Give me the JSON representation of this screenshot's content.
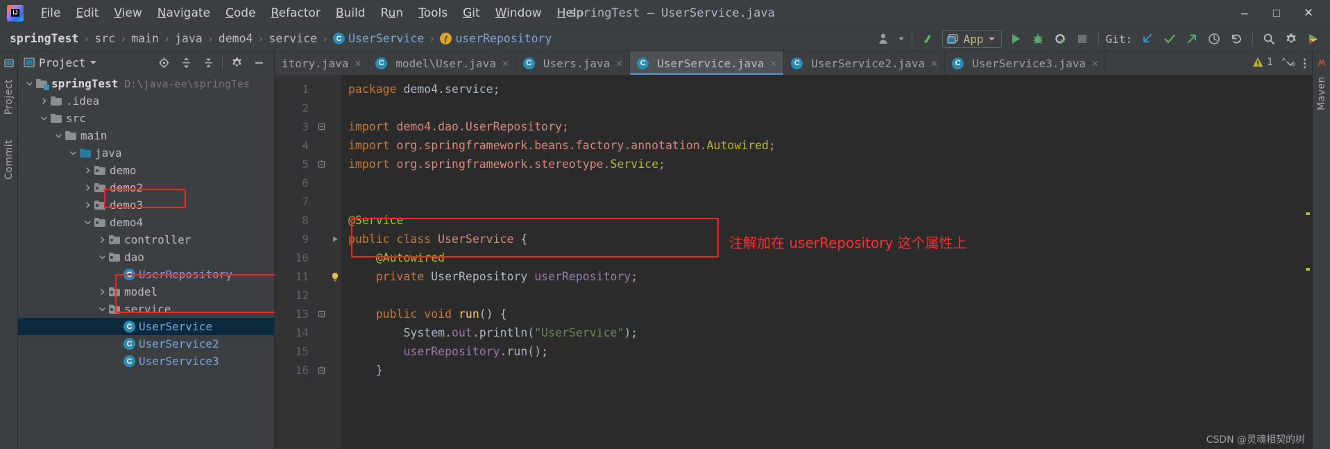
{
  "window": {
    "title": "springTest – UserService.java",
    "logo_text": "IJ",
    "controls": {
      "minimize": "–",
      "maximize": "□",
      "close": "✕"
    }
  },
  "menubar": {
    "items": [
      {
        "label": "File",
        "mnemonic": "F"
      },
      {
        "label": "Edit",
        "mnemonic": "E"
      },
      {
        "label": "View",
        "mnemonic": "V"
      },
      {
        "label": "Navigate",
        "mnemonic": "N"
      },
      {
        "label": "Code",
        "mnemonic": "C"
      },
      {
        "label": "Refactor",
        "mnemonic": "R"
      },
      {
        "label": "Build",
        "mnemonic": "B"
      },
      {
        "label": "Run",
        "mnemonic": "u"
      },
      {
        "label": "Tools",
        "mnemonic": "T"
      },
      {
        "label": "Git",
        "mnemonic": "G"
      },
      {
        "label": "Window",
        "mnemonic": "W"
      },
      {
        "label": "Help",
        "mnemonic": "H"
      }
    ]
  },
  "breadcrumb": {
    "items": [
      {
        "label": "springTest",
        "style": "bold"
      },
      {
        "label": "src",
        "style": "plain"
      },
      {
        "label": "main",
        "style": "plain"
      },
      {
        "label": "java",
        "style": "plain"
      },
      {
        "label": "demo4",
        "style": "plain"
      },
      {
        "label": "service",
        "style": "plain"
      },
      {
        "label": "UserService",
        "style": "blue",
        "badge": "C"
      },
      {
        "label": "userRepository",
        "style": "blue",
        "badge": "f"
      }
    ],
    "separator": "›"
  },
  "toolbar": {
    "run_config": "App",
    "git_label": "Git:",
    "icons": [
      "user-avatar-icon",
      "chevron-down-icon",
      "update-project-icon",
      "run-icon",
      "debug-icon",
      "run-coverage-icon",
      "stop-icon",
      "git-update-icon",
      "git-commit-icon",
      "git-push-icon",
      "git-history-icon",
      "git-rollback-icon",
      "search-everywhere-icon",
      "settings-gear-icon",
      "ide-assistant-icon"
    ]
  },
  "left_strip": {
    "tabs": [
      "Project",
      "Commit"
    ]
  },
  "right_strip": {
    "tabs": [
      "Maven"
    ]
  },
  "project_panel": {
    "title": "Project",
    "header_icons": [
      "locate-icon",
      "expand-all-icon",
      "collapse-all-icon",
      "settings-gear-icon",
      "hide-icon"
    ],
    "tree": [
      {
        "label": "springTest",
        "path": "D:\\java-ee\\springTes",
        "indent": 0,
        "twisty": "v",
        "icon": "module-folder",
        "style": "bold"
      },
      {
        "label": ".idea",
        "indent": 1,
        "twisty": ">",
        "icon": "folder",
        "style": "plain"
      },
      {
        "label": "src",
        "indent": 1,
        "twisty": "v",
        "icon": "folder",
        "style": "plain"
      },
      {
        "label": "main",
        "indent": 2,
        "twisty": "v",
        "icon": "folder",
        "style": "plain"
      },
      {
        "label": "java",
        "indent": 3,
        "twisty": "v",
        "icon": "source-folder",
        "style": "plain"
      },
      {
        "label": "demo",
        "indent": 4,
        "twisty": ">",
        "icon": "package-folder",
        "style": "plain"
      },
      {
        "label": "demo2",
        "indent": 4,
        "twisty": ">",
        "icon": "package-folder",
        "style": "plain"
      },
      {
        "label": "demo3",
        "indent": 4,
        "twisty": ">",
        "icon": "package-folder",
        "style": "plain"
      },
      {
        "label": "demo4",
        "indent": 4,
        "twisty": "v",
        "icon": "package-folder",
        "style": "plain",
        "highlight": true
      },
      {
        "label": "controller",
        "indent": 5,
        "twisty": ">",
        "icon": "package-folder",
        "style": "plain"
      },
      {
        "label": "dao",
        "indent": 5,
        "twisty": "v",
        "icon": "package-folder",
        "style": "plain"
      },
      {
        "label": "UserRepository",
        "indent": 6,
        "twisty": "",
        "icon": "class",
        "style": "blue"
      },
      {
        "label": "model",
        "indent": 5,
        "twisty": ">",
        "icon": "package-folder",
        "style": "plain"
      },
      {
        "label": "service",
        "indent": 5,
        "twisty": "v",
        "icon": "package-folder",
        "style": "plain",
        "highlight": true
      },
      {
        "label": "UserService",
        "indent": 6,
        "twisty": "",
        "icon": "class",
        "style": "blue",
        "selected": true,
        "highlight": true
      },
      {
        "label": "UserService2",
        "indent": 6,
        "twisty": "",
        "icon": "class",
        "style": "blue"
      },
      {
        "label": "UserService3",
        "indent": 6,
        "twisty": "",
        "icon": "class",
        "style": "blue"
      }
    ]
  },
  "editor_tabs": [
    {
      "label": "itory.java",
      "icon": "",
      "active": false,
      "truncated": true
    },
    {
      "label": "model\\User.java",
      "icon": "C",
      "active": false
    },
    {
      "label": "Users.java",
      "icon": "C",
      "active": false
    },
    {
      "label": "UserService.java",
      "icon": "C",
      "active": true
    },
    {
      "label": "UserService2.java",
      "icon": "C",
      "active": false
    },
    {
      "label": "UserService3.java",
      "icon": "C",
      "active": false
    }
  ],
  "editor_tabs_right_icons": [
    "chevron-down-icon",
    "more-options-icon"
  ],
  "inspection_widget": {
    "warning_count": "1",
    "icon": "warning-triangle-icon",
    "up": "⌃",
    "down": "⌄"
  },
  "code": {
    "lines": [
      {
        "n": 1,
        "fold": "",
        "tokens": [
          {
            "t": "package ",
            "c": "kw"
          },
          {
            "t": "demo4.service;",
            "c": "pkgname"
          }
        ]
      },
      {
        "n": 2,
        "fold": "",
        "tokens": []
      },
      {
        "n": 3,
        "fold": "-",
        "tokens": [
          {
            "t": "import ",
            "c": "kw"
          },
          {
            "t": "demo4.dao.UserRepository;",
            "c": "type"
          }
        ]
      },
      {
        "n": 4,
        "fold": "",
        "tokens": [
          {
            "t": "import ",
            "c": "kw"
          },
          {
            "t": "org.springframework.beans.factory.annotation.",
            "c": "type"
          },
          {
            "t": "Autowired",
            "c": "ann"
          },
          {
            "t": ";",
            "c": "type"
          }
        ]
      },
      {
        "n": 5,
        "fold": "=",
        "tokens": [
          {
            "t": "import ",
            "c": "kw"
          },
          {
            "t": "org.springframework.stereotype.",
            "c": "type"
          },
          {
            "t": "Service",
            "c": "ann"
          },
          {
            "t": ";",
            "c": "type"
          }
        ]
      },
      {
        "n": 6,
        "fold": "",
        "tokens": []
      },
      {
        "n": 7,
        "fold": "",
        "tokens": []
      },
      {
        "n": 8,
        "fold": "",
        "tokens": [
          {
            "t": "@Service",
            "c": "ann"
          }
        ]
      },
      {
        "n": 9,
        "fold": "",
        "tokens": [
          {
            "t": "public ",
            "c": "kw"
          },
          {
            "t": "class ",
            "c": "kw"
          },
          {
            "t": "UserService",
            "c": "type"
          },
          {
            "t": " {",
            "c": "cls"
          }
        ]
      },
      {
        "n": 10,
        "fold": "",
        "tokens": [
          {
            "t": "    @Autowired",
            "c": "ann"
          }
        ]
      },
      {
        "n": 11,
        "fold": "",
        "tokens": [
          {
            "t": "    ",
            "c": "cls"
          },
          {
            "t": "private ",
            "c": "kw"
          },
          {
            "t": "UserRepository ",
            "c": "cls"
          },
          {
            "t": "userRepository",
            "c": "fld"
          },
          {
            "t": ";",
            "c": "cls"
          }
        ]
      },
      {
        "n": 12,
        "fold": "",
        "tokens": []
      },
      {
        "n": 13,
        "fold": "-",
        "tokens": [
          {
            "t": "    ",
            "c": "cls"
          },
          {
            "t": "public ",
            "c": "kw"
          },
          {
            "t": "void ",
            "c": "kw"
          },
          {
            "t": "run",
            "c": "mth"
          },
          {
            "t": "() {",
            "c": "cls"
          }
        ]
      },
      {
        "n": 14,
        "fold": "",
        "tokens": [
          {
            "t": "        System.",
            "c": "cls"
          },
          {
            "t": "out",
            "c": "fld"
          },
          {
            "t": ".println(",
            "c": "cls"
          },
          {
            "t": "\"UserService\"",
            "c": "str"
          },
          {
            "t": ");",
            "c": "cls"
          }
        ]
      },
      {
        "n": 15,
        "fold": "",
        "tokens": [
          {
            "t": "        ",
            "c": "cls"
          },
          {
            "t": "userRepository",
            "c": "fld"
          },
          {
            "t": ".run();",
            "c": "cls"
          }
        ]
      },
      {
        "n": 16,
        "fold": "=",
        "tokens": [
          {
            "t": "    }",
            "c": "cls"
          }
        ]
      }
    ]
  },
  "annotations": {
    "note_text": "注解加在 userRepository 这个属性上",
    "color": "#ff2d2d"
  },
  "watermark": "CSDN @灵魂相契的树"
}
